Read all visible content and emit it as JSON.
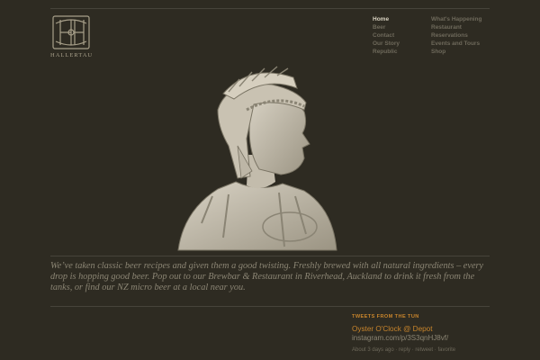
{
  "logo": {
    "text": "HALLERTAU",
    "icon": "hallertau-monogram-icon"
  },
  "nav": {
    "col1": [
      {
        "label": "Home",
        "active": true
      },
      {
        "label": "Beer"
      },
      {
        "label": "Contact"
      },
      {
        "label": "Our Story"
      },
      {
        "label": "Republic"
      }
    ],
    "col2": [
      {
        "label": "What's Happening"
      },
      {
        "label": "Restaurant"
      },
      {
        "label": "Reservations"
      },
      {
        "label": "Events and Tours"
      },
      {
        "label": "Shop"
      }
    ]
  },
  "hero": {
    "image": "roman-centurion-bust-relief"
  },
  "intro": {
    "text": "We’ve taken classic beer recipes and given them a good twisting. Freshly brewed with all natural ingredients – every drop is hopping good beer. Pop out to our Brewbar & Restaurant in Riverhead, Auckland to drink it fresh from the tanks, or find our NZ micro beer at a local near you."
  },
  "tweets": {
    "heading": "TWEETS FROM THE TUN",
    "items": [
      {
        "text": "Oyster O'Clock @ Depot",
        "link": "instagram.com/p/3S3qnHJ8vf/",
        "time": "About 3 days ago",
        "sep": "·",
        "reply": "reply",
        "retweet": "retweet",
        "favorite": "favorite"
      }
    ]
  },
  "colors": {
    "background": "#2e2b22",
    "accent": "#c8852c",
    "text_muted": "#8b8574",
    "nav_active": "#d9d3c2"
  }
}
